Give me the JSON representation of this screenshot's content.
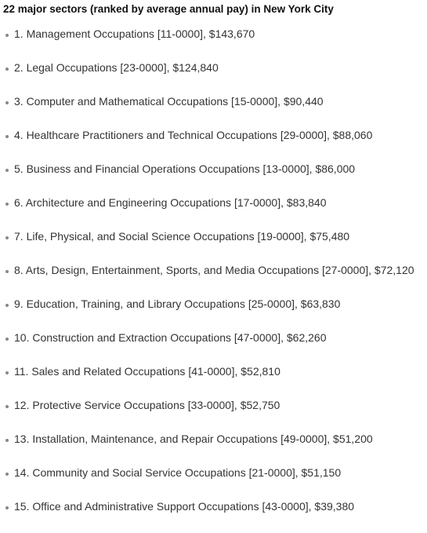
{
  "heading": "22 major sectors (ranked by average annual pay) in New York City",
  "items": [
    "1. Management Occupations [11-0000], $143,670",
    "2. Legal Occupations [23-0000], $124,840",
    "3. Computer and Mathematical Occupations [15-0000], $90,440",
    "4. Healthcare Practitioners and Technical Occupations [29-0000], $88,060",
    "5. Business and Financial Operations Occupations [13-0000], $86,000",
    "6. Architecture and Engineering Occupations [17-0000], $83,840",
    "7. Life, Physical, and Social Science Occupations [19-0000], $75,480",
    "8. Arts, Design, Entertainment, Sports, and Media Occupations [27-0000], $72,120",
    "9. Education, Training, and Library Occupations [25-0000], $63,830",
    "10. Construction and Extraction Occupations [47-0000], $62,260",
    "11. Sales and Related Occupations [41-0000], $52,810",
    "12. Protective Service Occupations [33-0000], $52,750",
    "13. Installation, Maintenance, and Repair Occupations [49-0000], $51,200",
    "14. Community and Social Service Occupations [21-0000], $51,150",
    "15. Office and Administrative Support Occupations [43-0000], $39,380"
  ]
}
